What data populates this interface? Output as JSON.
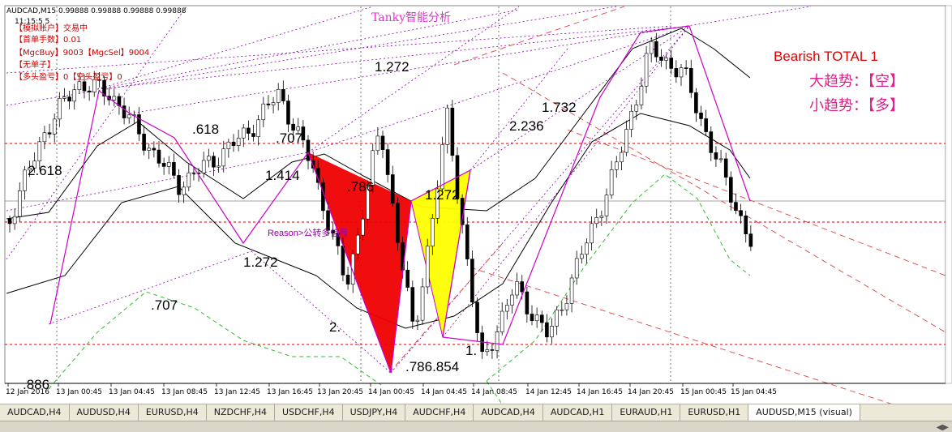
{
  "window": {
    "symbol_header": "AUDCAD,M15  0.99888 0.99888 0.99888 0.99888"
  },
  "colors": {
    "bg": "#ffffff",
    "candle": "#000000",
    "zigzag": "#cc00cc",
    "red_level": "#d40000",
    "fib_dot": "#8800aa",
    "green_band": "#33bb33",
    "tri_red": "#ee0000",
    "tri_yellow": "#ffff00"
  },
  "info_panel": {
    "time": "11:15:5 5",
    "lines": [
      "【模拟账户】交易中",
      "【首单手数】0.01",
      "【MgcBuy】9003【MgcSel】9004",
      "【无单子】",
      "【多头盈亏】0【空头盈亏】0"
    ]
  },
  "watermark": "Tanky智能分析",
  "signal_panel": {
    "title": "Bearish TOTAL 1",
    "big_trend": "大趋势：【空】",
    "small_trend": "小趋势：【多】"
  },
  "fib_labels": [
    "2.618",
    ".618",
    ".707",
    "1.414",
    ".786",
    "1.272",
    "1.272",
    "1.272",
    "1.732",
    "2.236",
    ".707",
    "2.",
    ".786.854",
    "1.",
    ".886"
  ],
  "signal_text": "Reason>公转多信号",
  "xaxis_ticks": [
    "12 Jan 2016",
    "13 Jan 00:45",
    "13 Jan 04:45",
    "13 Jan 08:45",
    "13 Jan 12:45",
    "13 Jan 16:45",
    "13 Jan 20:45",
    "14 Jan 00:45",
    "14 Jan 04:45",
    "14 Jan 08:45",
    "14 Jan 12:45",
    "14 Jan 16:45",
    "14 Jan 20:45",
    "15 Jan 00:45",
    "15 Jan 04:45"
  ],
  "tabs": [
    "AUDCAD,H4",
    "AUDUSD,H4",
    "EURUSD,H4",
    "NZDCHF,H4",
    "USDCHF,H4",
    "USDJPY,H4",
    "AUDCHF,H4",
    "AUDCAD,H4",
    "AUDCAD,H1",
    "EURAUD,H1",
    "EURUSD,H1",
    "AUDUSD,M15 (visual)"
  ],
  "active_tab": "AUDUSD,M15 (visual)",
  "chart_data": {
    "type": "candlestick",
    "symbol": "AUDCAD",
    "timeframe": "M15",
    "x": [
      "12 Jan 2016",
      "13 Jan 00:45",
      "13 Jan 04:45",
      "13 Jan 08:45",
      "13 Jan 12:45",
      "13 Jan 16:45",
      "13 Jan 20:45",
      "14 Jan 00:45",
      "14 Jan 04:45",
      "14 Jan 08:45",
      "14 Jan 12:45",
      "14 Jan 16:45",
      "14 Jan 20:45",
      "15 Jan 00:45",
      "15 Jan 04:45"
    ],
    "close_path": [
      0.45,
      0.7,
      0.85,
      0.82,
      0.68,
      0.55,
      0.62,
      0.7,
      0.82,
      0.6,
      0.25,
      0.72,
      0.1,
      0.75,
      0.02,
      0.25,
      0.1,
      0.35,
      0.6,
      0.95,
      0.88,
      0.62,
      0.38
    ],
    "zigzag_pivots": [
      0.25,
      0.8,
      0.55,
      0.65,
      0.5,
      0.72,
      0.05,
      0.2,
      0.85,
      0.1,
      0.3,
      0.97,
      0.85,
      0.98,
      0.4
    ],
    "annotations": [
      "2.618",
      ".618",
      ".707",
      "1.414",
      ".786",
      "1.272",
      "1.732",
      "2.236",
      ".886"
    ]
  }
}
